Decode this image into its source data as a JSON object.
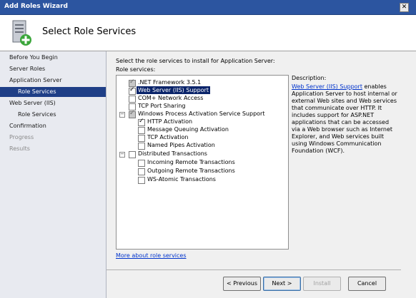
{
  "window": {
    "title": "Add Roles Wizard",
    "close_glyph": "✕"
  },
  "header": {
    "title": "Select Role Services",
    "icon": "server-add-icon"
  },
  "nav": [
    {
      "label": "Before You Begin"
    },
    {
      "label": "Server Roles"
    },
    {
      "label": "Application Server"
    },
    {
      "label": "Role Services"
    },
    {
      "label": "Web Server (IIS)"
    },
    {
      "label": "Role Services"
    },
    {
      "label": "Confirmation"
    },
    {
      "label": "Progress"
    },
    {
      "label": "Results"
    }
  ],
  "main": {
    "instruction": "Select the role services to install for Application Server:",
    "list_label": "Role services:",
    "more_link": "More about role services"
  },
  "tree": [
    {
      "label": ".NET Framework 3.5.1"
    },
    {
      "label": "Web Server (IIS) Support"
    },
    {
      "label": "COM+ Network Access"
    },
    {
      "label": "TCP Port Sharing"
    },
    {
      "label": "Windows Process Activation Service Support"
    },
    {
      "label": "HTTP Activation"
    },
    {
      "label": "Message Queuing Activation"
    },
    {
      "label": "TCP Activation"
    },
    {
      "label": "Named Pipes Activation"
    },
    {
      "label": "Distributed Transactions"
    },
    {
      "label": "Incoming Remote Transactions"
    },
    {
      "label": "Outgoing Remote Transactions"
    },
    {
      "label": "WS-Atomic Transactions"
    }
  ],
  "description": {
    "heading": "Description:",
    "link": "Web Server (IIS) Support",
    "text": " enables Application Server to host internal or external Web sites and Web services that communicate over HTTP. It includes support for ASP.NET applications that can be accessed via a Web browser such as Internet Explorer, and Web services built using Windows Communication Foundation (WCF)."
  },
  "buttons": {
    "previous": "< Previous",
    "next": "Next >",
    "install": "Install",
    "cancel": "Cancel"
  },
  "colors": {
    "titlebar": "#2c55a0",
    "nav_selected": "#1f3f87",
    "link": "#0033cc"
  }
}
